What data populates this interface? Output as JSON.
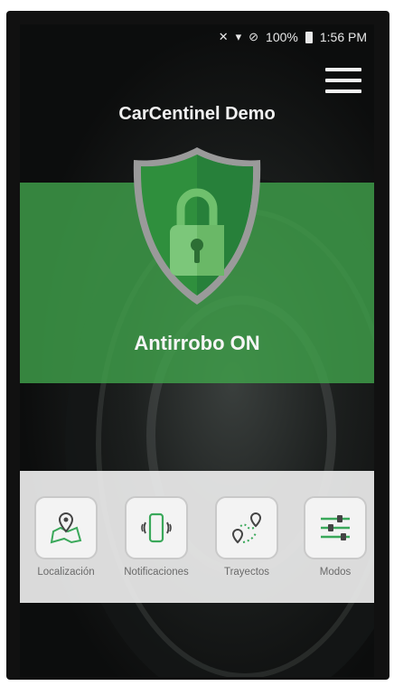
{
  "status_bar": {
    "battery": "100%",
    "time": "1:56 PM"
  },
  "app": {
    "title": "CarCentinel Demo"
  },
  "alarm": {
    "status": "Antirrobo ON"
  },
  "nav": [
    {
      "label": "Localización",
      "icon": "map-pin-icon"
    },
    {
      "label": "Notificaciones",
      "icon": "phone-vibrate-icon"
    },
    {
      "label": "Trayectos",
      "icon": "route-icon"
    },
    {
      "label": "Modos",
      "icon": "sliders-icon"
    }
  ],
  "colors": {
    "accent_green": "#40a04a",
    "icon_green": "#3aa85a",
    "panel": "#ebebeb"
  }
}
